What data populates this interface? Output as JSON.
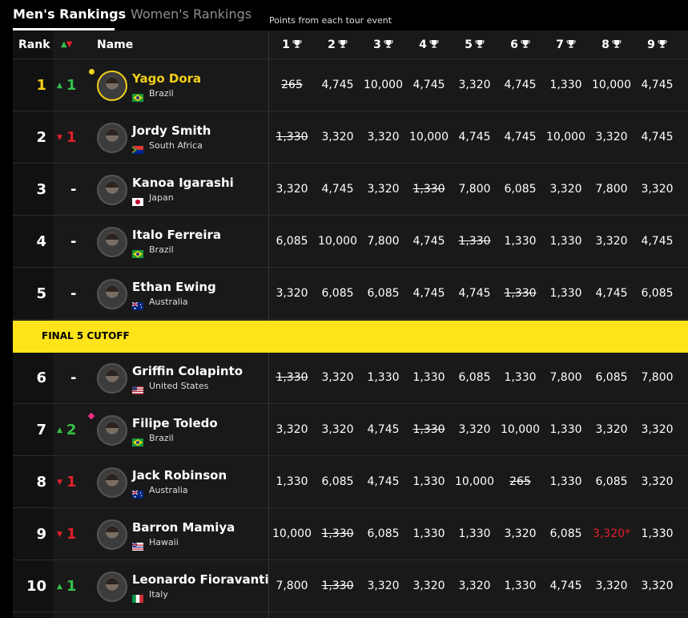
{
  "tabs": [
    {
      "label": "Men's Rankings",
      "active": true
    },
    {
      "label": "Women's Rankings",
      "active": false
    }
  ],
  "points_caption": "Points from each tour event",
  "header": {
    "rank": "Rank",
    "name": "Name",
    "events": [
      "1",
      "2",
      "3",
      "4",
      "5",
      "6",
      "7",
      "8",
      "9"
    ]
  },
  "colors": {
    "gold": "#f2cf1a",
    "up": "#35c04a",
    "down": "#e0202a",
    "cutoff": "#fde31a"
  },
  "cutoff_label": "FINAL 5 CUTOFF",
  "rows": [
    {
      "rank": "1",
      "move": "1",
      "dir": "up",
      "name": "Yago Dora",
      "country": "Brazil",
      "flag": "brazil",
      "leader": true,
      "badge": "yellow",
      "scores": [
        "265",
        "4,745",
        "10,000",
        "4,745",
        "3,320",
        "4,745",
        "1,330",
        "10,000",
        "4,745"
      ],
      "strike": [
        0
      ],
      "red": []
    },
    {
      "rank": "2",
      "move": "1",
      "dir": "down",
      "name": "Jordy Smith",
      "country": "South Africa",
      "flag": "south-africa",
      "scores": [
        "1,330",
        "3,320",
        "3,320",
        "10,000",
        "4,745",
        "4,745",
        "10,000",
        "3,320",
        "4,745"
      ],
      "strike": [
        0
      ],
      "red": []
    },
    {
      "rank": "3",
      "move": "-",
      "dir": "flat",
      "name": "Kanoa Igarashi",
      "country": "Japan",
      "flag": "japan",
      "scores": [
        "3,320",
        "4,745",
        "3,320",
        "1,330",
        "7,800",
        "6,085",
        "3,320",
        "7,800",
        "3,320"
      ],
      "strike": [
        3
      ],
      "red": []
    },
    {
      "rank": "4",
      "move": "-",
      "dir": "flat",
      "name": "Italo Ferreira",
      "country": "Brazil",
      "flag": "brazil",
      "scores": [
        "6,085",
        "10,000",
        "7,800",
        "4,745",
        "1,330",
        "1,330",
        "1,330",
        "3,320",
        "4,745"
      ],
      "strike": [
        4
      ],
      "red": []
    },
    {
      "rank": "5",
      "move": "-",
      "dir": "flat",
      "name": "Ethan Ewing",
      "country": "Australia",
      "flag": "australia",
      "scores": [
        "3,320",
        "6,085",
        "6,085",
        "4,745",
        "4,745",
        "1,330",
        "1,330",
        "4,745",
        "6,085"
      ],
      "strike": [
        5
      ],
      "red": []
    },
    {
      "rank": "6",
      "move": "-",
      "dir": "flat",
      "name": "Griffin Colapinto",
      "country": "United States",
      "flag": "usa",
      "scores": [
        "1,330",
        "3,320",
        "1,330",
        "1,330",
        "6,085",
        "1,330",
        "7,800",
        "6,085",
        "7,800"
      ],
      "strike": [
        0
      ],
      "red": []
    },
    {
      "rank": "7",
      "move": "2",
      "dir": "up",
      "name": "Filipe Toledo",
      "country": "Brazil",
      "flag": "brazil",
      "badge": "pink",
      "scores": [
        "3,320",
        "3,320",
        "4,745",
        "1,330",
        "3,320",
        "10,000",
        "1,330",
        "3,320",
        "3,320"
      ],
      "strike": [
        3
      ],
      "red": []
    },
    {
      "rank": "8",
      "move": "1",
      "dir": "down",
      "name": "Jack Robinson",
      "country": "Australia",
      "flag": "australia",
      "scores": [
        "1,330",
        "6,085",
        "4,745",
        "1,330",
        "10,000",
        "265",
        "1,330",
        "6,085",
        "3,320"
      ],
      "strike": [
        5
      ],
      "red": []
    },
    {
      "rank": "9",
      "move": "1",
      "dir": "down",
      "name": "Barron Mamiya",
      "country": "Hawaii",
      "flag": "hawaii",
      "scores": [
        "10,000",
        "1,330",
        "6,085",
        "1,330",
        "1,330",
        "3,320",
        "6,085",
        "3,320*",
        "1,330"
      ],
      "strike": [
        1
      ],
      "red": [
        7
      ]
    },
    {
      "rank": "10",
      "move": "1",
      "dir": "up",
      "name": "Leonardo Fioravanti",
      "country": "Italy",
      "flag": "italy",
      "scores": [
        "7,800",
        "1,330",
        "3,320",
        "3,320",
        "3,320",
        "1,330",
        "4,745",
        "3,320",
        "3,320"
      ],
      "strike": [
        1
      ],
      "red": []
    }
  ]
}
